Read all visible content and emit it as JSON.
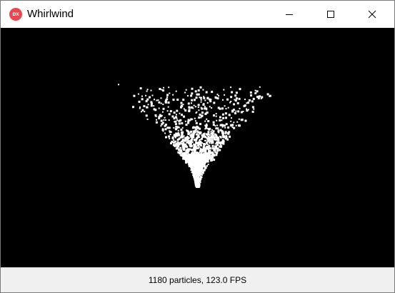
{
  "window": {
    "title": "Whirlwind",
    "app_icon_text": "DX",
    "app_icon_color": "#e8484f"
  },
  "controls": {
    "minimize": "minimize-icon",
    "maximize": "maximize-icon",
    "close": "close-icon"
  },
  "status": {
    "text": "1180 particles, 123.0 FPS"
  },
  "colors": {
    "canvas_background": "#000000",
    "particle": "#ffffff",
    "statusbar_background": "#f0f0f0"
  }
}
